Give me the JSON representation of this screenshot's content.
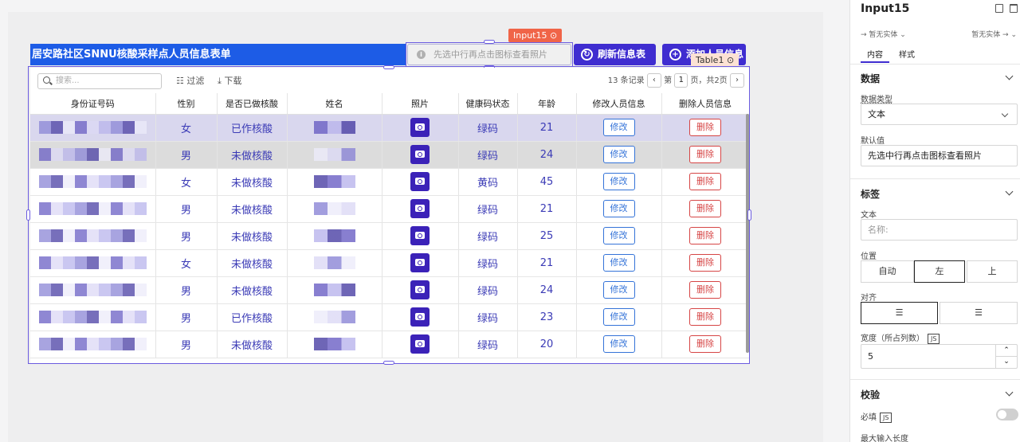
{
  "canvas": {
    "title_bar": "居安路社区SNNU核酸采样点人员信息表单",
    "input_placeholder": "先选中行再点击图标查看照片",
    "tag_input": "Input15 ⊙",
    "tag_table": "Table1 ⊙",
    "btn_refresh": "刷新信息表",
    "btn_add": "添加人员信息"
  },
  "table": {
    "search_placeholder": "搜索...",
    "filter_label": "过滤",
    "download_label": "下载",
    "records": "13 条记录",
    "page_prefix": "第",
    "page_current": "1",
    "page_suffix": "页，共2页",
    "columns": [
      "身份证号码",
      "性别",
      "是否已做核酸",
      "姓名",
      "照片",
      "健康码状态",
      "年龄",
      "修改人员信息",
      "删除人员信息"
    ],
    "edit_label": "修改",
    "delete_label": "删除",
    "rows": [
      {
        "gender": "女",
        "tested": "已作核酸",
        "code": "绿码",
        "age": "21"
      },
      {
        "gender": "男",
        "tested": "未做核酸",
        "code": "绿码",
        "age": "24"
      },
      {
        "gender": "女",
        "tested": "未做核酸",
        "code": "黄码",
        "age": "45"
      },
      {
        "gender": "男",
        "tested": "未做核酸",
        "code": "绿码",
        "age": "21"
      },
      {
        "gender": "男",
        "tested": "未做核酸",
        "code": "绿码",
        "age": "25"
      },
      {
        "gender": "女",
        "tested": "未做核酸",
        "code": "绿码",
        "age": "21"
      },
      {
        "gender": "男",
        "tested": "未做核酸",
        "code": "绿码",
        "age": "24"
      },
      {
        "gender": "男",
        "tested": "已作核酸",
        "code": "绿码",
        "age": "23"
      },
      {
        "gender": "男",
        "tested": "未做核酸",
        "code": "绿码",
        "age": "20"
      }
    ]
  },
  "panel": {
    "title": "Input15",
    "link_left": "→ 暂无实体 ⌄",
    "link_right": "暂无实体 → ⌄",
    "tab_content": "内容",
    "tab_style": "样式",
    "sec_data": "数据",
    "data_type_label": "数据类型",
    "data_type_value": "文本",
    "default_label": "默认值",
    "default_value": "先选中行再点击图标查看照片",
    "sec_label": "标签",
    "text_label": "文本",
    "text_placeholder": "名称:",
    "position_label": "位置",
    "pos_auto": "自动",
    "pos_left": "左",
    "pos_top": "上",
    "align_label": "对齐",
    "width_label": "宽度（所占列数）",
    "js": "JS",
    "width_value": "5",
    "sec_validate": "校验",
    "required_label": "必填",
    "maxlen_label": "最大输入长度"
  }
}
